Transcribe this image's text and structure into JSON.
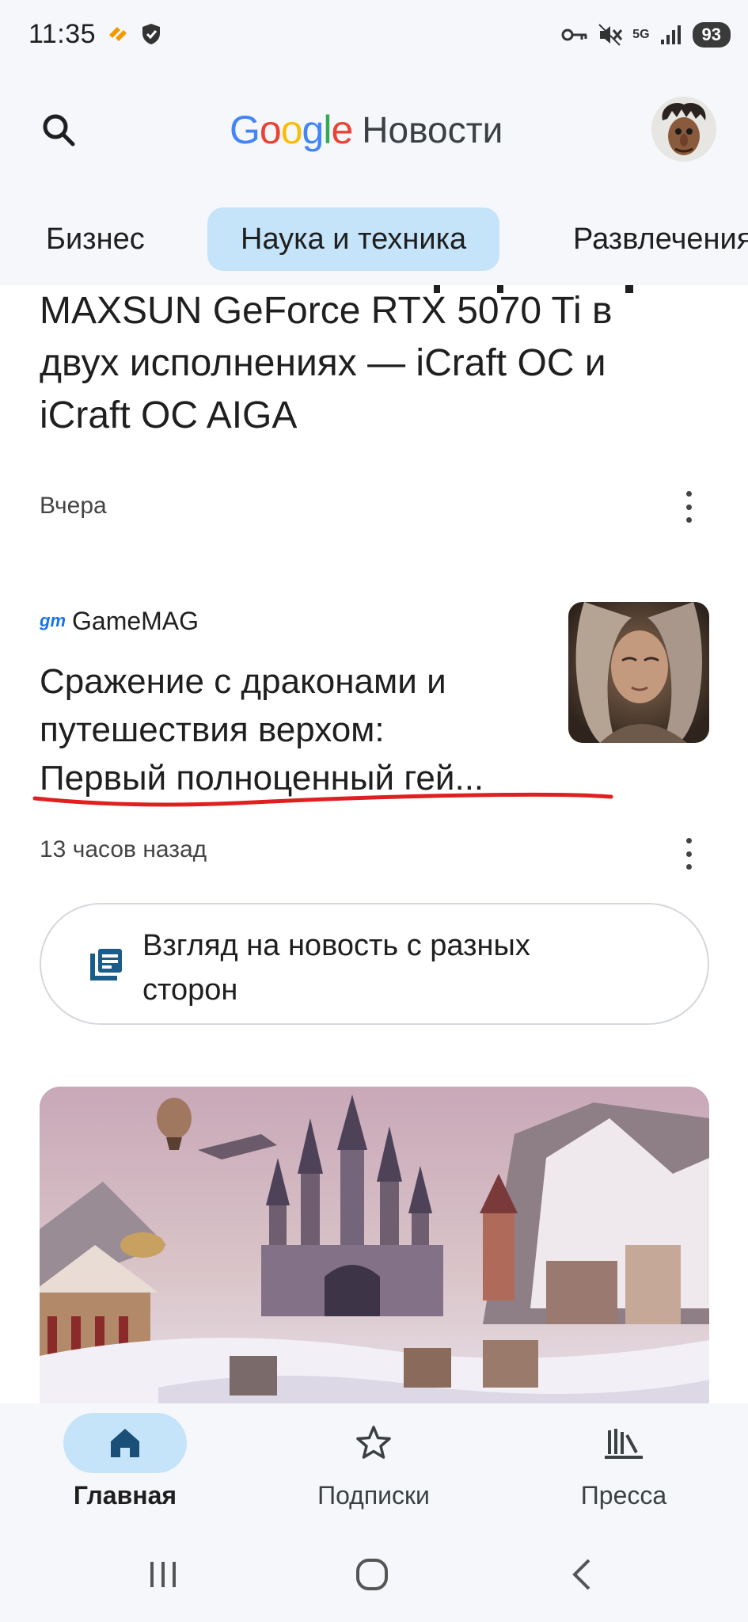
{
  "status_bar": {
    "time": "11:35",
    "network": "5G",
    "battery": "93"
  },
  "header": {
    "logo_google": [
      "G",
      "o",
      "o",
      "g",
      "l",
      "e"
    ],
    "logo_colors": [
      "#4285F4",
      "#EA4335",
      "#FBBC05",
      "#4285F4",
      "#34A853",
      "#EA4335"
    ],
    "logo_news": "Новости",
    "search_icon": "search-icon"
  },
  "tabs": [
    {
      "label": "Бизнес",
      "active": false
    },
    {
      "label": "Наука и техника",
      "active": true
    },
    {
      "label": "Развлечения",
      "active": false
    }
  ],
  "articles": [
    {
      "title_lines": [
        "MAXSUN GeForce RTX 5070 Ti в",
        "двух исполнениях — iCraft OC и",
        "iCraft OC AIGA"
      ],
      "time": "Вчера"
    },
    {
      "source_logo": "gm",
      "source": "GameMAG",
      "title_lines": [
        "Сражение с драконами и",
        "путешествия верхом:",
        "Первый полноценный гей..."
      ],
      "time": "13 часов назад"
    }
  ],
  "perspective_button": {
    "label_lines": [
      "Взгляд на новость с разных",
      "сторон"
    ]
  },
  "bottom_nav": [
    {
      "label": "Главная",
      "icon": "home-icon",
      "active": true
    },
    {
      "label": "Подписки",
      "icon": "star-icon",
      "active": false
    },
    {
      "label": "Пресса",
      "icon": "newsstand-icon",
      "active": false
    }
  ],
  "colors": {
    "accent": "#c5e4f9",
    "nav_icon": "#1a5c8a",
    "underline": "#e02020"
  }
}
